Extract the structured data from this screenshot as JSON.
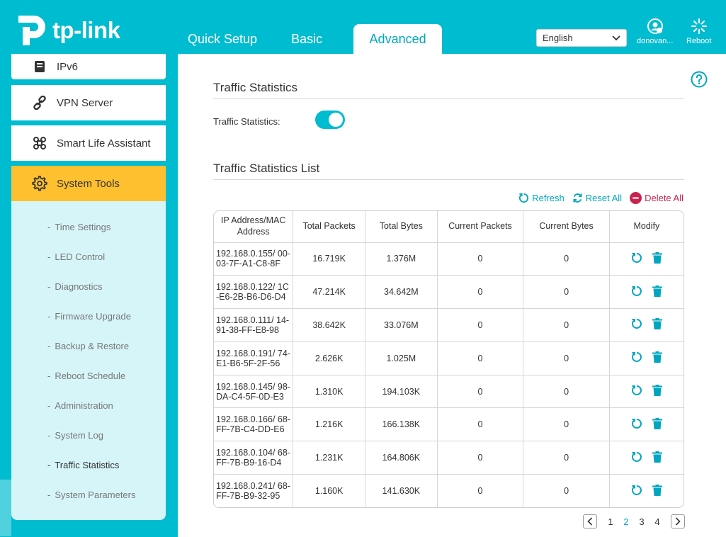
{
  "brand": {
    "logo_text": "tp-link"
  },
  "nav": {
    "tabs": [
      {
        "label": "Quick Setup"
      },
      {
        "label": "Basic"
      },
      {
        "label": "Advanced"
      }
    ]
  },
  "header": {
    "language": "English",
    "account_label": "donovan...",
    "reboot_label": "Reboot"
  },
  "sidebar": {
    "items": [
      {
        "label": "IPv6"
      },
      {
        "label": "VPN Server"
      },
      {
        "label": "Smart Life Assistant"
      },
      {
        "label": "System Tools"
      }
    ],
    "submenu": [
      {
        "label": "Time Settings"
      },
      {
        "label": "LED Control"
      },
      {
        "label": "Diagnostics"
      },
      {
        "label": "Firmware Upgrade"
      },
      {
        "label": "Backup & Restore"
      },
      {
        "label": "Reboot Schedule"
      },
      {
        "label": "Administration"
      },
      {
        "label": "System Log"
      },
      {
        "label": "Traffic Statistics"
      },
      {
        "label": "System Parameters"
      }
    ]
  },
  "main": {
    "section1_title": "Traffic Statistics",
    "toggle_label": "Traffic Statistics:",
    "toggle_on": true,
    "section2_title": "Traffic Statistics List",
    "actions": {
      "refresh": "Refresh",
      "reset_all": "Reset All",
      "delete_all": "Delete All"
    },
    "table": {
      "headers": [
        "IP Address/MAC Address",
        "Total Packets",
        "Total Bytes",
        "Current Packets",
        "Current Bytes",
        "Modify"
      ],
      "rows": [
        {
          "addr": "192.168.0.155/ 00-03-7F-A1-C8-8F",
          "total_packets": "16.719K",
          "total_bytes": "1.376M",
          "current_packets": "0",
          "current_bytes": "0"
        },
        {
          "addr": "192.168.0.122/ 1C-E6-2B-B6-D6-D4",
          "total_packets": "47.214K",
          "total_bytes": "34.642M",
          "current_packets": "0",
          "current_bytes": "0"
        },
        {
          "addr": "192.168.0.111/ 14-91-38-FF-E8-98",
          "total_packets": "38.642K",
          "total_bytes": "33.076M",
          "current_packets": "0",
          "current_bytes": "0"
        },
        {
          "addr": "192.168.0.191/ 74-E1-B6-5F-2F-56",
          "total_packets": "2.626K",
          "total_bytes": "1.025M",
          "current_packets": "0",
          "current_bytes": "0"
        },
        {
          "addr": "192.168.0.145/ 98-DA-C4-5F-0D-E3",
          "total_packets": "1.310K",
          "total_bytes": "194.103K",
          "current_packets": "0",
          "current_bytes": "0"
        },
        {
          "addr": "192.168.0.166/ 68-FF-7B-C4-DD-E6",
          "total_packets": "1.216K",
          "total_bytes": "166.138K",
          "current_packets": "0",
          "current_bytes": "0"
        },
        {
          "addr": "192.168.0.104/ 68-FF-7B-B9-16-D4",
          "total_packets": "1.231K",
          "total_bytes": "164.806K",
          "current_packets": "0",
          "current_bytes": "0"
        },
        {
          "addr": "192.168.0.241/ 68-FF-7B-B9-32-95",
          "total_packets": "1.160K",
          "total_bytes": "141.630K",
          "current_packets": "0",
          "current_bytes": "0"
        }
      ]
    },
    "pagination": {
      "pages": [
        "1",
        "2",
        "3",
        "4"
      ],
      "current": "2"
    }
  },
  "colors": {
    "brand": "#00bcd0",
    "accent": "#00a6bf",
    "active_menu": "#ffc030",
    "delete": "#c8234f"
  }
}
